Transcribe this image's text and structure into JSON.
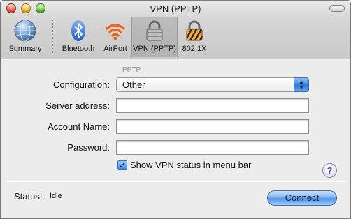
{
  "window": {
    "title": "VPN (PPTP)"
  },
  "toolbar": {
    "items": [
      {
        "label": "Summary",
        "icon": "globe-icon",
        "selected": false
      },
      {
        "label": "Bluetooth",
        "icon": "bluetooth-icon",
        "selected": false
      },
      {
        "label": "AirPort",
        "icon": "wifi-icon",
        "selected": false
      },
      {
        "label": "VPN (PPTP)",
        "icon": "lock-icon",
        "selected": true
      },
      {
        "label": "802.1X",
        "icon": "lock-striped-icon",
        "selected": false
      }
    ]
  },
  "form": {
    "section": "PPTP",
    "configuration": {
      "label": "Configuration:",
      "value": "Other"
    },
    "server_address": {
      "label": "Server address:",
      "value": ""
    },
    "account_name": {
      "label": "Account Name:",
      "value": ""
    },
    "password": {
      "label": "Password:",
      "value": ""
    },
    "show_status": {
      "label": "Show VPN status in menu bar",
      "checked": true
    }
  },
  "help": {
    "glyph": "?"
  },
  "status": {
    "label": "Status:",
    "value": "Idle"
  },
  "actions": {
    "connect": "Connect"
  },
  "colors": {
    "accent": "#3a86e0",
    "help": "#5b3ea8"
  }
}
